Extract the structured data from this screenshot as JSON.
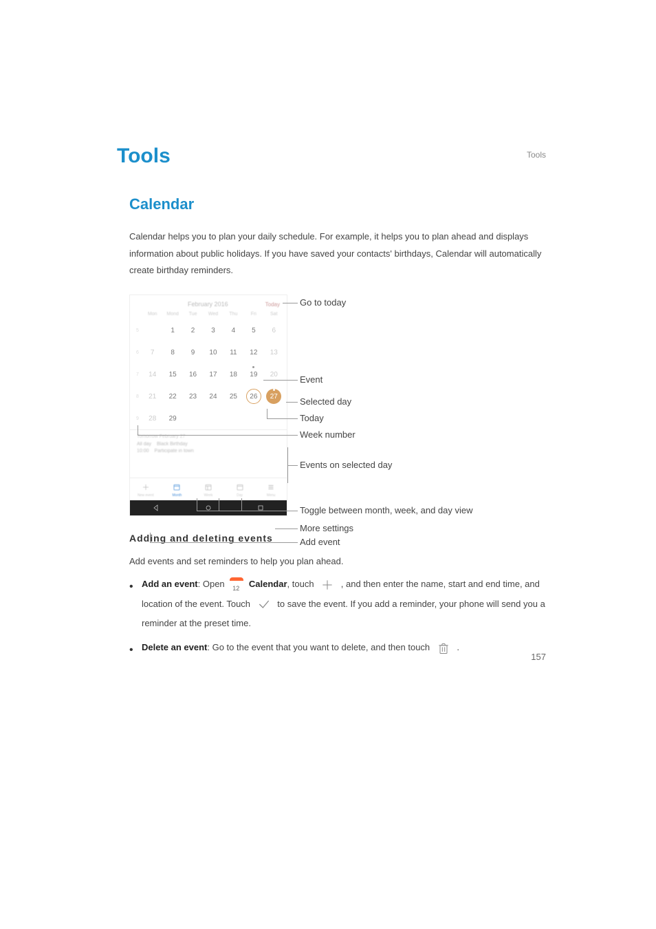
{
  "header": "Tools",
  "chapter_title": "Tools",
  "section_title": "Calendar",
  "intro": "Calendar helps you to plan your daily schedule. For example, it helps you to plan ahead and displays information about public holidays. If you have saved your contacts' birthdays, Calendar will automatically create birthday reminders.",
  "subheading": "Adding and deleting events",
  "sub_intro": "Add events and set reminders to help you plan ahead.",
  "bullets": {
    "add": {
      "label_bold": "Add an event",
      "part1": ": Open ",
      "app_name": "Calendar",
      "part2": ", touch ",
      "part3": " , and then enter the name, start and end time, and location of the event. Touch ",
      "part4": " to save the event. If you add a reminder, your phone will send you a reminder at the preset time."
    },
    "delete": {
      "label_bold": "Delete an event",
      "part1": ": Go to the event that you want to delete, and then touch ",
      "part2": " ."
    }
  },
  "page_number": "157",
  "figure": {
    "month_title": "February 2016",
    "today_label": "Today",
    "dow": [
      "Mon",
      "Mond",
      "Tue",
      "Wed",
      "Thu",
      "Fri",
      "Sat"
    ],
    "weeks": [
      {
        "wk": "5",
        "days": [
          "",
          "1",
          "2",
          "3",
          "4",
          "5",
          "6"
        ]
      },
      {
        "wk": "6",
        "days": [
          "7",
          "8",
          "9",
          "10",
          "11",
          "12",
          "13"
        ]
      },
      {
        "wk": "7",
        "days": [
          "14",
          "15",
          "16",
          "17",
          "18",
          "19",
          "20"
        ]
      },
      {
        "wk": "8",
        "days": [
          "21",
          "22",
          "23",
          "24",
          "25",
          "26",
          "27"
        ]
      },
      {
        "wk": "9",
        "days": [
          "28",
          "29",
          "",
          "",
          "",
          "",
          ""
        ]
      }
    ],
    "event_header": "Tomorrow February 27",
    "event1_time": "All day",
    "event1_text": "Black Birthday",
    "event2_time": "10:00",
    "event2_text": "Participate in town",
    "tabs": [
      "New event",
      "Month",
      "Week",
      "Day",
      "Menu"
    ],
    "callouts": {
      "goto_today": "Go to today",
      "event": "Event",
      "selected_day": "Selected day",
      "today": "Today",
      "week_number": "Week number",
      "events_on_day": "Events on selected day",
      "toggle_view": "Toggle between month, week, and day view",
      "more_settings": "More settings",
      "add_event": "Add event"
    }
  }
}
